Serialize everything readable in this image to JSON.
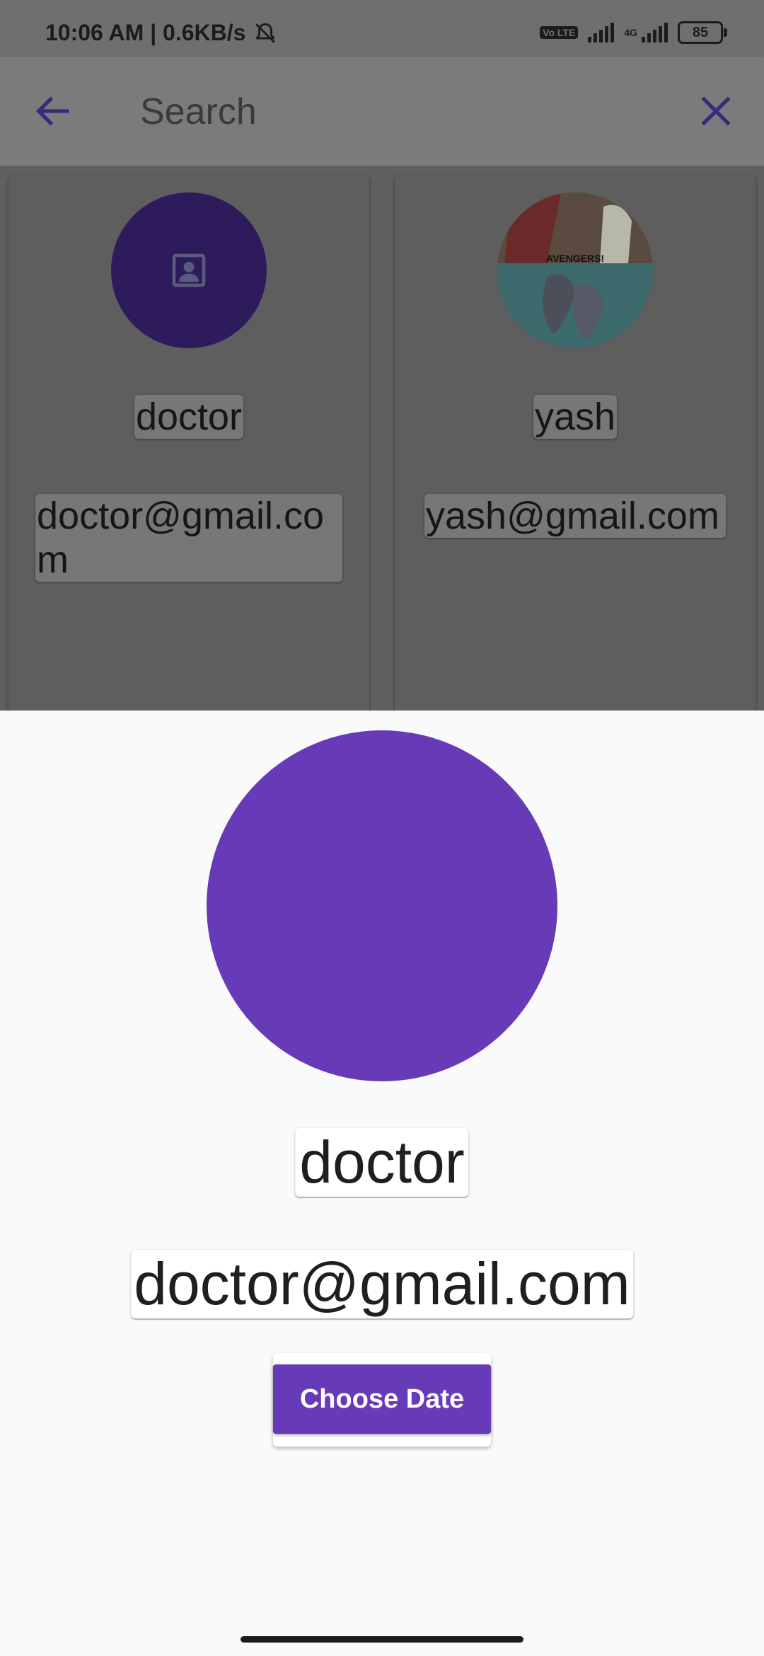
{
  "status_bar": {
    "time_speed": "10:06 AM | 0.6KB/s",
    "volte": "Vo LTE",
    "network": "4G",
    "battery": "85"
  },
  "app_bar": {
    "title": "Search"
  },
  "results": [
    {
      "name": "doctor",
      "email": "doctor@gmail.com",
      "avatar": "placeholder-person-icon"
    },
    {
      "name": "yash",
      "email": "yash@gmail.com",
      "avatar": "cartoon-photo"
    }
  ],
  "detail": {
    "name": "doctor",
    "email": "doctor@gmail.com",
    "choose_date_label": "Choose Date"
  },
  "colors": {
    "accent": "#673ab7",
    "status_bar": "#6f6f6f",
    "app_bar": "#7b7b7b",
    "sheet_bg": "#fafafa"
  },
  "photo_caption": "AVENGERS!"
}
